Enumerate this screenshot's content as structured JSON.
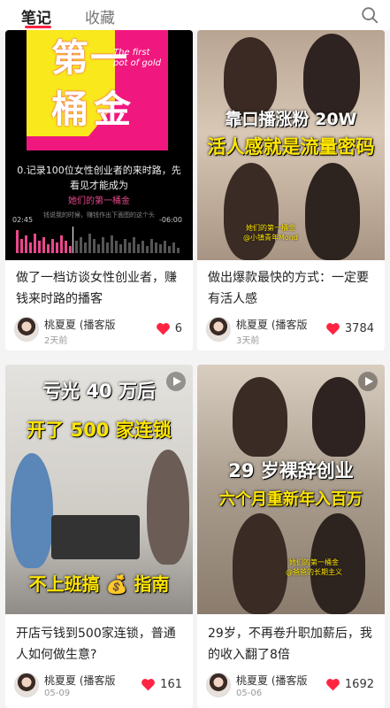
{
  "tabs": [
    {
      "label": "笔记",
      "active": true
    },
    {
      "label": "收藏",
      "active": false
    }
  ],
  "accent_color": "#ff2442",
  "cards": [
    {
      "title": "做了一档访谈女性创业者，赚钱来时路的播客",
      "author": "桃夏夏 (播客版",
      "date": "2天前",
      "likes": "6",
      "cover": {
        "chars": [
          "第",
          "一",
          "桶",
          "金"
        ],
        "english": "The first pot of gold",
        "subtitle": "0.记录100位女性创业者的来时路，先看见才能成为",
        "pink_text": "她们的第一桶金",
        "small_text": "钱说我的时候，赚钱作出下面图的这个头",
        "time_left": "02:45",
        "time_right": "-06:00"
      }
    },
    {
      "title": "做出爆款最快的方式：一定要有活人感",
      "author": "桃夏夏 (播客版",
      "date": "3天前",
      "likes": "3784",
      "cover": {
        "line1": "靠口播涨粉 20W",
        "line2": "活人感就是流量密码",
        "caption1": "她们的第一桶金",
        "caption2": "@小镇青年Mond"
      }
    },
    {
      "title": "开店亏钱到500家连锁，普通人如何做生意?",
      "author": "桃夏夏 (播客版",
      "date": "05-09",
      "likes": "161",
      "cover": {
        "line1": "亏光 40 万后",
        "line2": "开了 500 家连锁",
        "line3": "不上班搞 💰 指南"
      }
    },
    {
      "title": "29岁，不再卷升职加薪后，我的收入翻了8倍",
      "author": "桃夏夏 (播客版",
      "date": "05-06",
      "likes": "1692",
      "cover": {
        "line1": "29 岁裸辞创业",
        "line2": "六个月重新年入百万",
        "caption1": "她们的第一桶金",
        "caption2": "@爸爸的长期主义"
      }
    }
  ]
}
